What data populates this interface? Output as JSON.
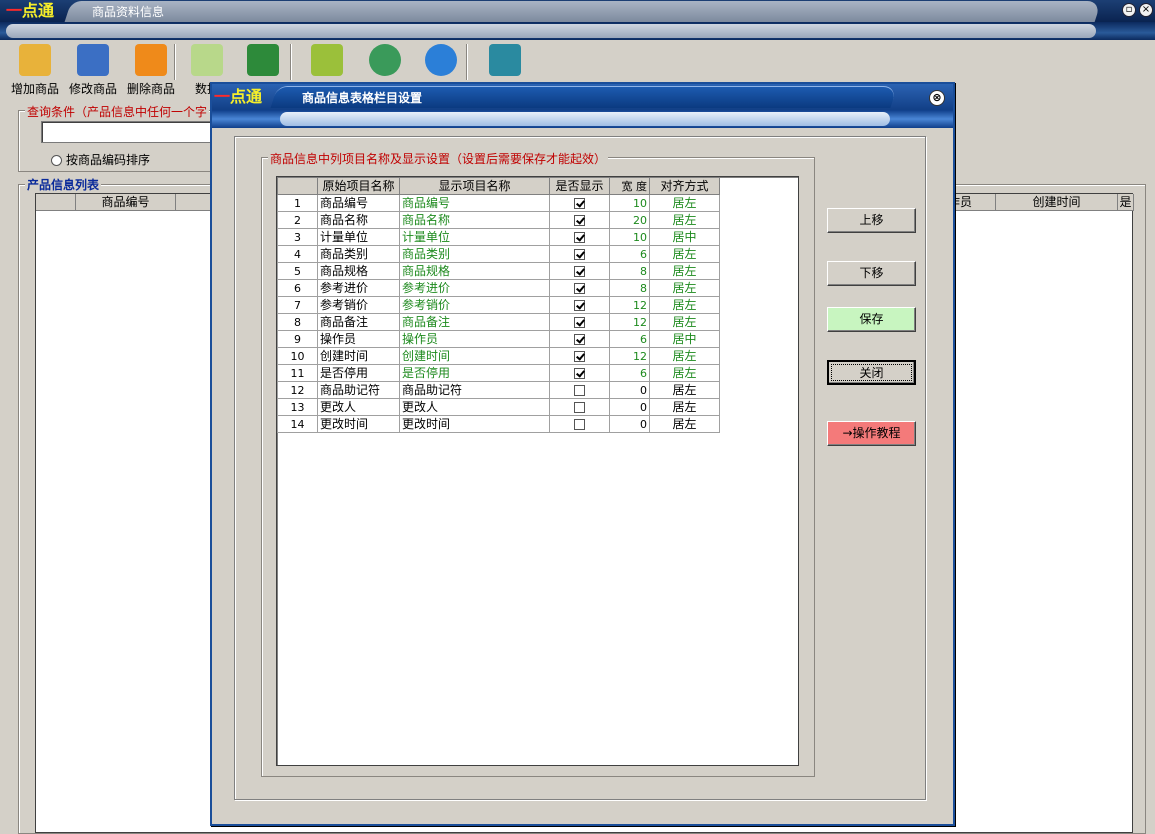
{
  "main_window": {
    "logo_part1": "一",
    "logo_part2": "点通",
    "title": "商品资料信息",
    "toolbar": [
      {
        "label": "增加商品",
        "icon": "add-folder-icon",
        "color": "#e8b23a"
      },
      {
        "label": "修改商品",
        "icon": "edit-user-icon",
        "color": "#3b6fc4"
      },
      {
        "label": "删除商品",
        "icon": "delete-folder-icon",
        "color": "#ef8a1a"
      },
      {
        "label": "数据",
        "icon": "data-icon",
        "color": "#b8d88a"
      },
      {
        "label": "",
        "icon": "excel-icon",
        "color": "#2d8a3a"
      },
      {
        "label": "",
        "icon": "list-icon",
        "color": "#9bc03a"
      },
      {
        "label": "",
        "icon": "chart-icon",
        "color": "#3a9a5a"
      },
      {
        "label": "",
        "icon": "help-icon",
        "color": "#2b7fd8"
      },
      {
        "label": "",
        "icon": "exit-icon",
        "color": "#2a8aa0"
      }
    ],
    "query_group_title": "查询条件（产品信息中任何一个字",
    "sort_option": "按商品编码排序",
    "list_group_title": "产品信息列表",
    "list_headers": {
      "code": "商品编号",
      "operator": "操作员",
      "created": "创建时间",
      "disabled": "是"
    }
  },
  "dialog": {
    "logo_part1": "一",
    "logo_part2": "点通",
    "title": "商品信息表格栏目设置",
    "close_symbol": "⊗",
    "group_title": "商品信息中列项目名称及显示设置（设置后需要保存才能起效）",
    "columns": [
      "",
      "原始项目名称",
      "显示项目名称",
      "是否显示",
      "宽 度",
      "对齐方式"
    ],
    "rows": [
      {
        "idx": "1",
        "orig": "商品编号",
        "disp": "商品编号",
        "show": true,
        "width": "10",
        "align": "居左"
      },
      {
        "idx": "2",
        "orig": "商品名称",
        "disp": "商品名称",
        "show": true,
        "width": "20",
        "align": "居左"
      },
      {
        "idx": "3",
        "orig": "计量单位",
        "disp": "计量单位",
        "show": true,
        "width": "10",
        "align": "居中"
      },
      {
        "idx": "4",
        "orig": "商品类别",
        "disp": "商品类别",
        "show": true,
        "width": "6",
        "align": "居左"
      },
      {
        "idx": "5",
        "orig": "商品规格",
        "disp": "商品规格",
        "show": true,
        "width": "8",
        "align": "居左"
      },
      {
        "idx": "6",
        "orig": "参考进价",
        "disp": "参考进价",
        "show": true,
        "width": "8",
        "align": "居左"
      },
      {
        "idx": "7",
        "orig": "参考销价",
        "disp": "参考销价",
        "show": true,
        "width": "12",
        "align": "居左"
      },
      {
        "idx": "8",
        "orig": "商品备注",
        "disp": "商品备注",
        "show": true,
        "width": "12",
        "align": "居左"
      },
      {
        "idx": "9",
        "orig": "操作员",
        "disp": "操作员",
        "show": true,
        "width": "6",
        "align": "居中"
      },
      {
        "idx": "10",
        "orig": "创建时间",
        "disp": "创建时间",
        "show": true,
        "width": "12",
        "align": "居左"
      },
      {
        "idx": "11",
        "orig": "是否停用",
        "disp": "是否停用",
        "show": true,
        "width": "6",
        "align": "居左"
      },
      {
        "idx": "12",
        "orig": "商品助记符",
        "disp": "商品助记符",
        "show": false,
        "width": "0",
        "align": "居左"
      },
      {
        "idx": "13",
        "orig": "更改人",
        "disp": "更改人",
        "show": false,
        "width": "0",
        "align": "居左"
      },
      {
        "idx": "14",
        "orig": "更改时间",
        "disp": "更改时间",
        "show": false,
        "width": "0",
        "align": "居左"
      }
    ],
    "buttons": {
      "up": "上移",
      "down": "下移",
      "save": "保存",
      "close": "关闭",
      "tutorial": "→操作教程"
    }
  }
}
